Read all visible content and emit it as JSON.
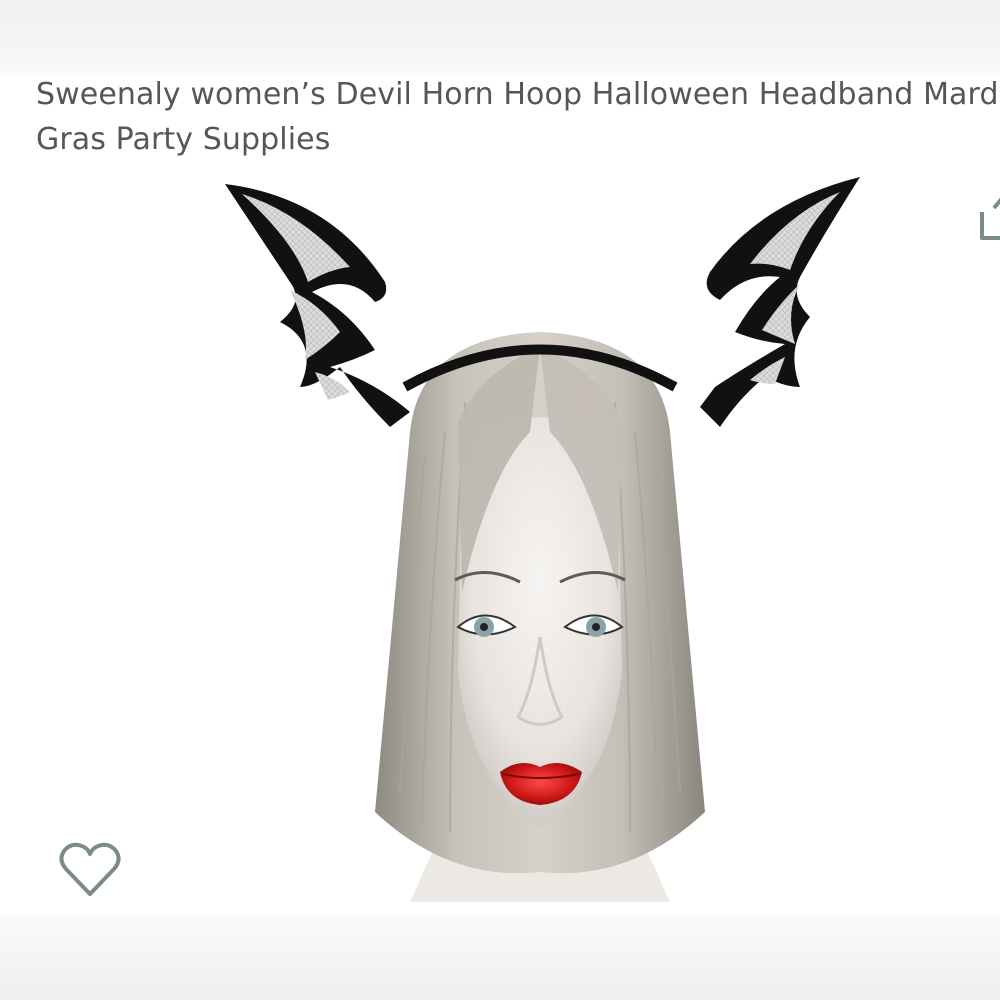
{
  "product": {
    "title": "Sweenaly women’s Devil Horn Hoop Halloween Headband Mardi Gras Party Supplies"
  },
  "icons": {
    "share": "share-icon",
    "wishlist": "heart-outline-icon"
  },
  "colors": {
    "title_text": "#565656",
    "icon_gray": "#7b8a8b",
    "lips": "#d21a1a",
    "headband": "#111111"
  }
}
